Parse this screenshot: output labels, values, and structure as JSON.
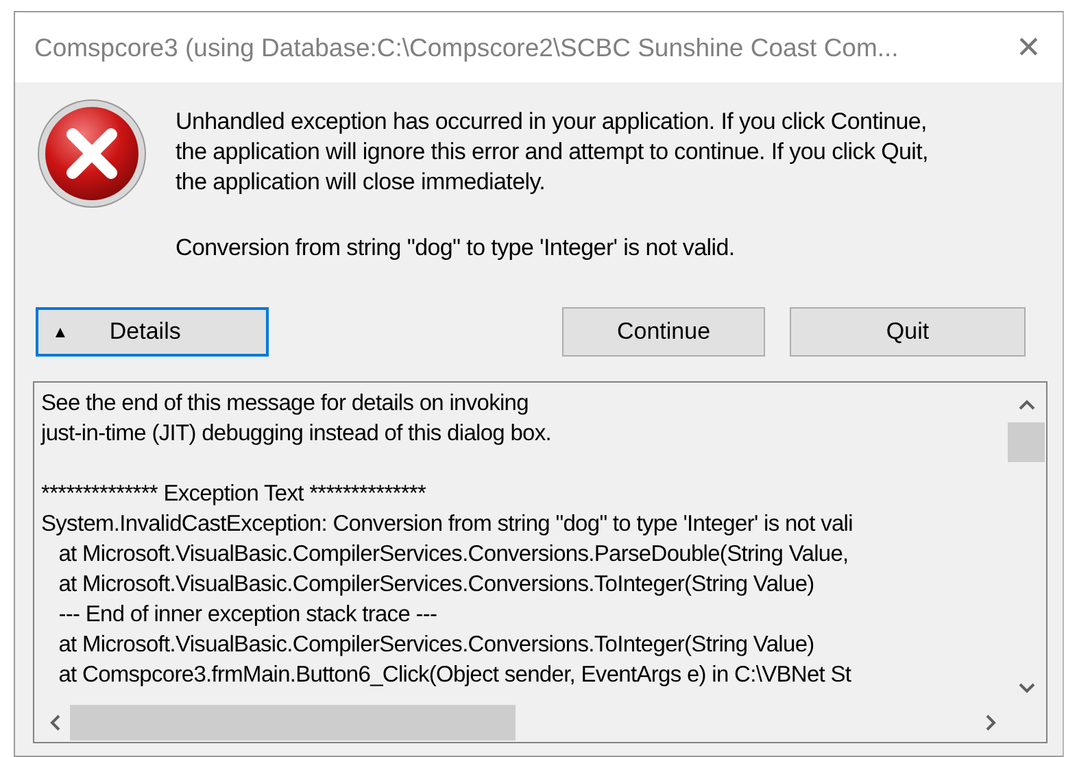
{
  "window": {
    "title": "Comspcore3 (using Database:C:\\Compscore2\\SCBC Sunshine Coast Com...",
    "close": "✕"
  },
  "message": {
    "paragraphs": [
      "Unhandled exception has occurred in your application. If you click Continue, the application will ignore this error and attempt to continue. If you click Quit, the application will close immediately.",
      "Conversion from string \"dog\" to type 'Integer' is not valid."
    ]
  },
  "buttons": [
    {
      "kind": "details",
      "glyph": "▲",
      "label": "Details",
      "focused": true
    },
    {
      "kind": "action",
      "label": "Continue",
      "focused": false
    },
    {
      "kind": "action",
      "label": "Quit",
      "focused": false
    }
  ],
  "details_text": {
    "blocks": [
      {
        "lines": [
          "See the end of this message for details on invoking",
          "just-in-time (JIT) debugging instead of this dialog box."
        ]
      },
      {
        "lines": [
          "************** Exception Text **************",
          "System.InvalidCastException: Conversion from string \"dog\" to type 'Integer' is not vali",
          "   at Microsoft.VisualBasic.CompilerServices.Conversions.ParseDouble(String Value,",
          "   at Microsoft.VisualBasic.CompilerServices.Conversions.ToInteger(String Value)",
          "   --- End of inner exception stack trace ---",
          "   at Microsoft.VisualBasic.CompilerServices.Conversions.ToInteger(String Value)",
          "   at Comspcore3.frmMain.Button6_Click(Object sender, EventArgs e) in C:\\VBNet St"
        ]
      }
    ]
  }
}
